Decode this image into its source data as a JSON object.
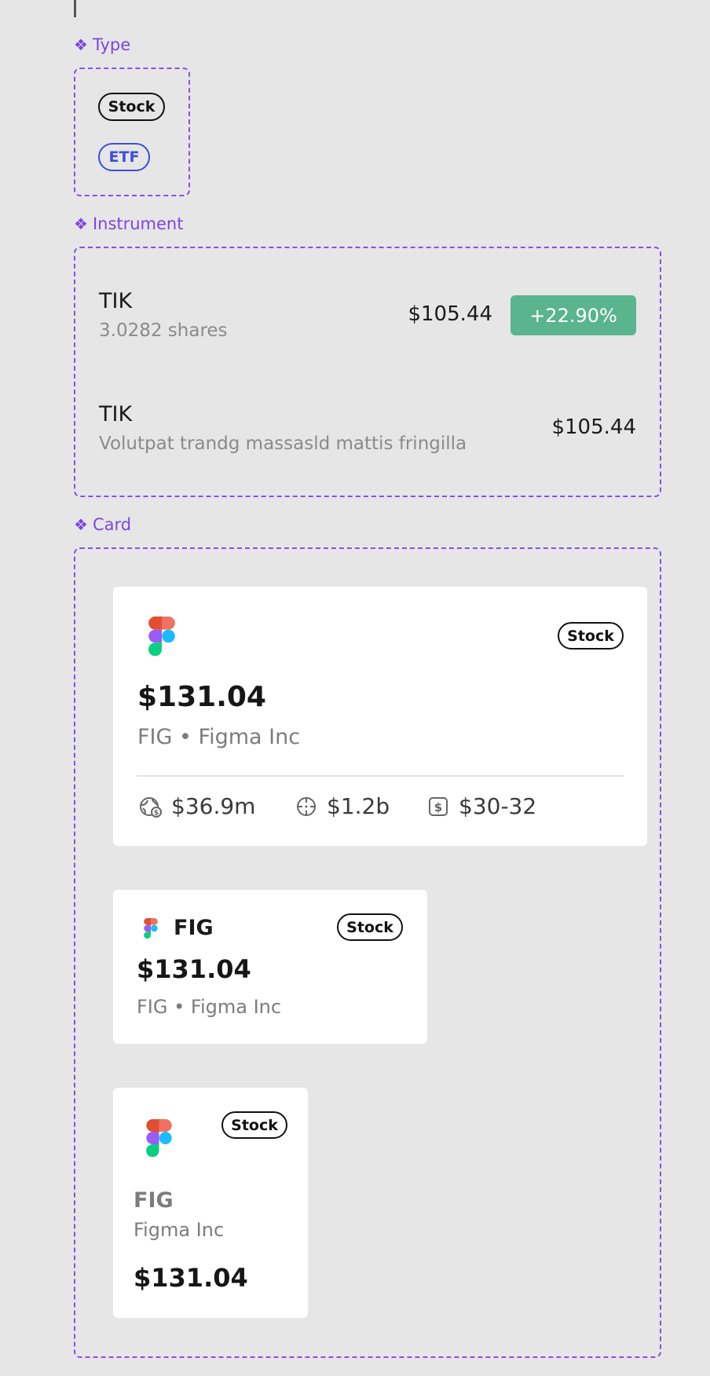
{
  "sections": {
    "type_label": "Type",
    "instrument_label": "Instrument",
    "card_label": "Card"
  },
  "type_pills": {
    "stock": "Stock",
    "etf": "ETF"
  },
  "instruments": [
    {
      "ticker": "TIK",
      "subtitle": "3.0282 shares",
      "price": "$105.44",
      "change": "+22.90%"
    },
    {
      "ticker": "TIK",
      "subtitle": "Volutpat trandg massasld mattis fringilla",
      "price": "$105.44"
    }
  ],
  "cards": {
    "large": {
      "badge": "Stock",
      "price": "$131.04",
      "name_line": "FIG • Figma Inc",
      "stats": [
        {
          "icon": "globe-dollar-icon",
          "value": "$36.9m"
        },
        {
          "icon": "crosshair-icon",
          "value": "$1.2b"
        },
        {
          "icon": "dollar-square-icon",
          "value": "$30-32"
        }
      ]
    },
    "medium": {
      "ticker": "FIG",
      "badge": "Stock",
      "price": "$131.04",
      "name_line": "FIG • Figma Inc"
    },
    "small": {
      "badge": "Stock",
      "ticker": "FIG",
      "company": "Figma Inc",
      "price": "$131.04"
    }
  },
  "colors": {
    "accent_purple": "#8a4ee8",
    "etf_blue": "#3b4fd8",
    "gain_green": "#5ab48e",
    "background": "#e6e6e7"
  }
}
